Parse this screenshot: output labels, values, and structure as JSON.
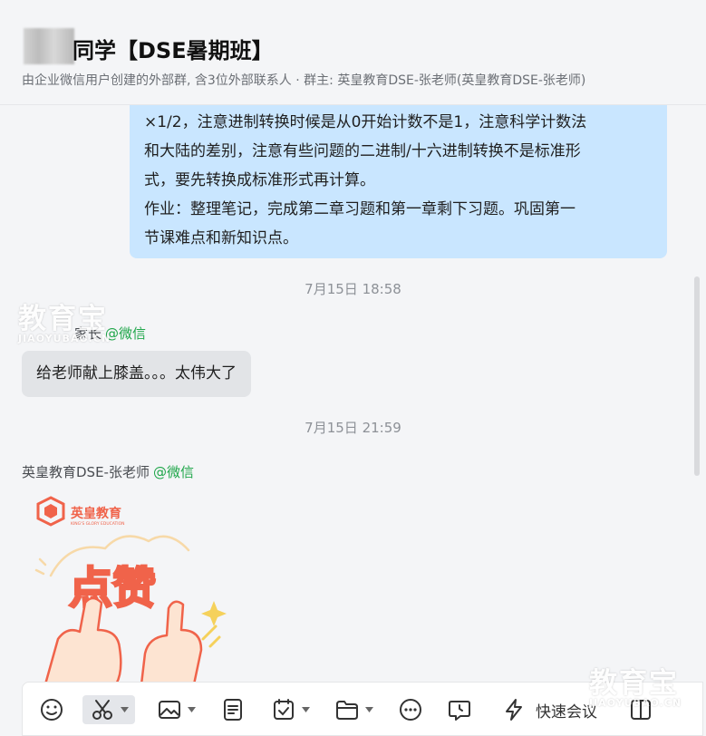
{
  "header": {
    "title": "同学【DSE暑期班】",
    "subtitle": "由企业微信用户创建的外部群, 含3位外部联系人 · 群主: 英皇教育DSE-张老师(英皇教育DSE-张老师)"
  },
  "messages": {
    "own_lines": [
      "×1/2，注意进制转换时候是从0开始计数不是1，注意科学计数法",
      "和大陆的差别，注意有些问题的二进制/十六进制转换不是标准形",
      "式，要先转换成标准形式再计算。",
      "作业：整理笔记，完成第二章习题和第一章剩下习题。巩固第一",
      "节课难点和新知识点。"
    ],
    "ts1": "7月15日 18:58",
    "sender1": "家长",
    "sender1_tag": "@微信",
    "msg1": "给老师献上膝盖。。。太伟大了",
    "ts2": "7月15日 21:59",
    "sender2": "英皇教育DSE-张老师",
    "sender2_tag": "@微信"
  },
  "sticker": {
    "brand": "英皇教育",
    "brand_en": "KING'S GLORY EDUCATION",
    "text": "点赞"
  },
  "watermark": {
    "text": "教育宝",
    "sub": "JIAOYUBAO.CN"
  },
  "toolbar": {
    "quick_meeting": "快速会议"
  },
  "colors": {
    "own_bubble": "#c9e6ff",
    "other_bubble": "#e2e4e7",
    "wechat_tag": "#1fa64a",
    "sticker_red": "#f0634a"
  },
  "icons": [
    "emoji-icon",
    "scissors-icon",
    "image-icon",
    "document-icon",
    "schedule-icon",
    "folder-icon",
    "more-icon",
    "chat-record-icon",
    "lightning-icon",
    "split-icon"
  ]
}
